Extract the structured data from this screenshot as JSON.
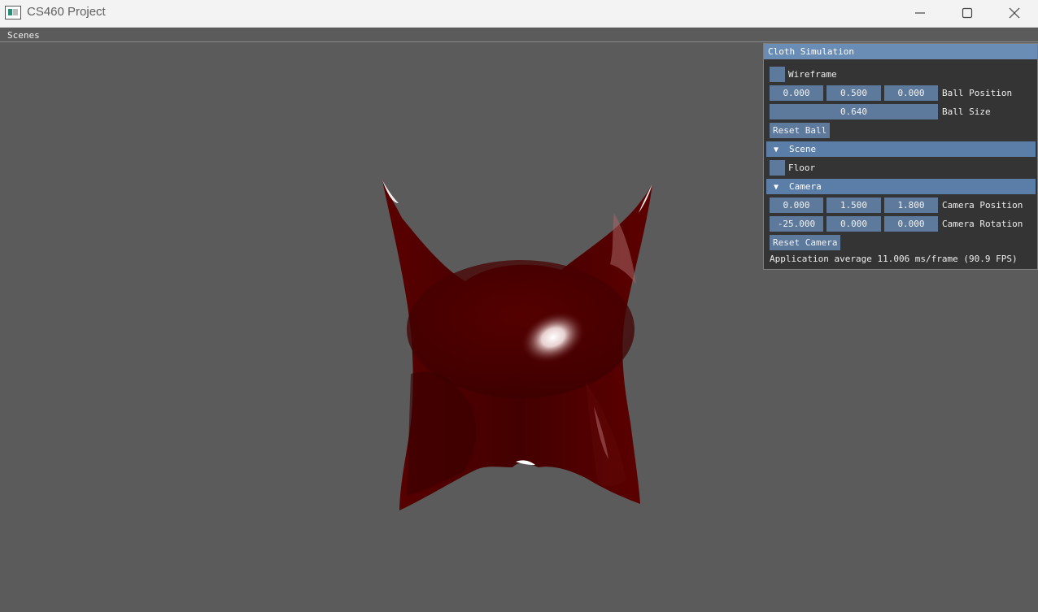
{
  "window": {
    "title": "CS460 Project"
  },
  "menu": {
    "scenes": "Scenes"
  },
  "panel": {
    "title": "Cloth Simulation",
    "wireframe_label": "Wireframe",
    "ball_position": {
      "x": "0.000",
      "y": "0.500",
      "z": "0.000",
      "label": "Ball Position"
    },
    "ball_size": {
      "value": "0.640",
      "label": "Ball Size"
    },
    "reset_ball": "Reset Ball",
    "scene_header": "Scene",
    "floor_label": "Floor",
    "camera_header": "Camera",
    "camera_position": {
      "x": "0.000",
      "y": "1.500",
      "z": "1.800",
      "label": "Camera Position"
    },
    "camera_rotation": {
      "x": "-25.000",
      "y": "0.000",
      "z": "0.000",
      "label": "Camera Rotation"
    },
    "reset_camera": "Reset Camera",
    "fps_text": "Application average 11.006 ms/frame (90.9 FPS)"
  },
  "colors": {
    "background": "#5b5b5b",
    "cloth": "#4a0000",
    "accent": "#5d7a9c"
  }
}
